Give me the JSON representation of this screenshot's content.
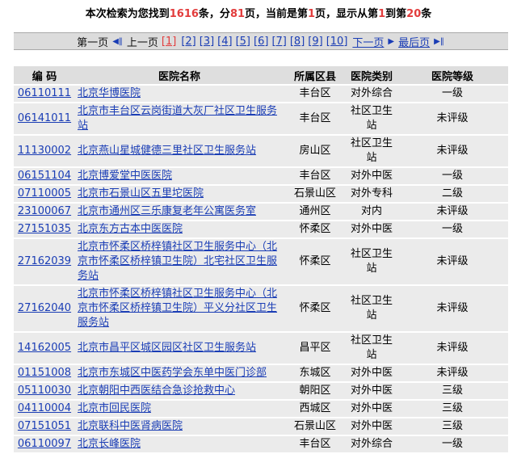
{
  "summary": {
    "prefix": "本次检索为您找到",
    "total": "1616",
    "mid1": "条，分",
    "pages": "81",
    "mid2": "页，当前是第",
    "current": "1",
    "mid3": "页，显示从第",
    "from": "1",
    "mid4": "到第",
    "to": "20",
    "suffix": "条"
  },
  "pager": {
    "first": "第一页",
    "prev": "上一页",
    "current": "[1]",
    "pages": [
      "[2]",
      "[3]",
      "[4]",
      "[5]",
      "[6]",
      "[7]",
      "[8]",
      "[9]",
      "[10]"
    ],
    "next": "下一页",
    "last": "最后页"
  },
  "table": {
    "headers": [
      "编 码",
      "医院名称",
      "所属区县",
      "医院类别",
      "医院等级"
    ],
    "rows": [
      {
        "code": "06110111",
        "name": "北京华博医院",
        "district": "丰台区",
        "type": "对外综合",
        "grade": "一级"
      },
      {
        "code": "06141011",
        "name": "北京市丰台区云岗街道大灰厂社区卫生服务站",
        "district": "丰台区",
        "type": "社区卫生站",
        "grade": "未评级"
      },
      {
        "code": "11130002",
        "name": "北京燕山星城健德三里社区卫生服务站",
        "district": "房山区",
        "type": "社区卫生站",
        "grade": "未评级"
      },
      {
        "code": "06151104",
        "name": "北京博爱堂中医医院",
        "district": "丰台区",
        "type": "对外中医",
        "grade": "一级"
      },
      {
        "code": "07110005",
        "name": "北京市石景山区五里坨医院",
        "district": "石景山区",
        "type": "对外专科",
        "grade": "二级"
      },
      {
        "code": "23100067",
        "name": "北京市通州区三乐康复老年公寓医务室",
        "district": "通州区",
        "type": "对内",
        "grade": "未评级"
      },
      {
        "code": "27151035",
        "name": "北京东方古本中医医院",
        "district": "怀柔区",
        "type": "对外中医",
        "grade": "一级"
      },
      {
        "code": "27162039",
        "name": "北京市怀柔区桥梓镇社区卫生服务中心（北京市怀柔区桥梓镇卫生院）北宅社区卫生服务站",
        "district": "怀柔区",
        "type": "社区卫生站",
        "grade": "未评级"
      },
      {
        "code": "27162040",
        "name": "北京市怀柔区桥梓镇社区卫生服务中心（北京市怀柔区桥梓镇卫生院）平义分社区卫生服务站",
        "district": "怀柔区",
        "type": "社区卫生站",
        "grade": "未评级"
      },
      {
        "code": "14162005",
        "name": "北京市昌平区城区园区社区卫生服务站",
        "district": "昌平区",
        "type": "社区卫生站",
        "grade": "未评级"
      },
      {
        "code": "01151008",
        "name": "北京市东城区中医药学会东单中医门诊部",
        "district": "东城区",
        "type": "对外中医",
        "grade": "未评级"
      },
      {
        "code": "05110030",
        "name": "北京朝阳中西医结合急诊抢救中心",
        "district": "朝阳区",
        "type": "对外中医",
        "grade": "三级"
      },
      {
        "code": "04110004",
        "name": "北京市回民医院",
        "district": "西城区",
        "type": "对外中医",
        "grade": "三级"
      },
      {
        "code": "07151051",
        "name": "北京联科中医肾病医院",
        "district": "石景山区",
        "type": "对外中医",
        "grade": "三级"
      },
      {
        "code": "06110097",
        "name": "北京长峰医院",
        "district": "丰台区",
        "type": "对外综合",
        "grade": "一级"
      }
    ]
  }
}
